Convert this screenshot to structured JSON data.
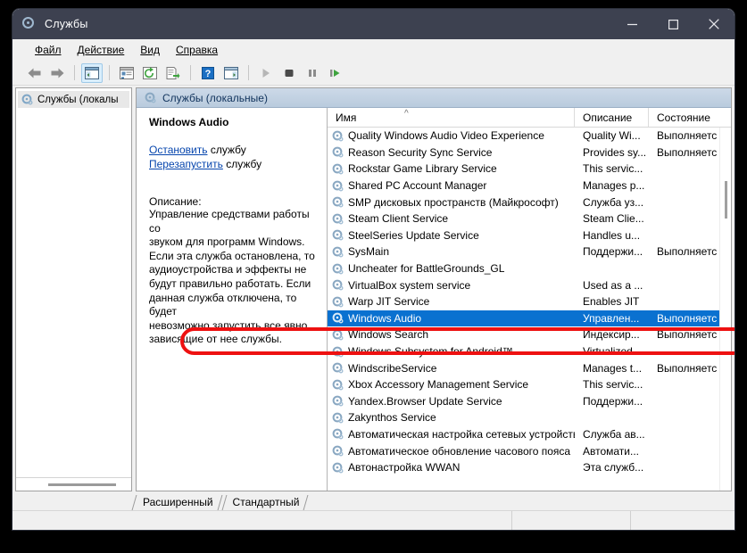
{
  "window": {
    "title": "Службы",
    "title_icon": "services-gear-icon",
    "minimize_label": "Свернуть",
    "maximize_label": "Развернуть",
    "close_label": "Закрыть"
  },
  "menubar": {
    "items": [
      {
        "label": "Файл",
        "accel": "Ф"
      },
      {
        "label": "Действие",
        "accel": "Д"
      },
      {
        "label": "Вид",
        "accel": "В"
      },
      {
        "label": "Справка",
        "accel": "С"
      }
    ]
  },
  "toolbar": {
    "buttons": [
      {
        "name": "back-icon",
        "label": "Назад"
      },
      {
        "name": "forward-icon",
        "label": "Вперед"
      },
      {
        "name": "show-hide-console-tree-icon",
        "label": "Показать или скрыть дерево консоли",
        "active": true
      },
      {
        "name": "properties-icon",
        "label": "Свойства"
      },
      {
        "name": "refresh-icon",
        "label": "Обновить"
      },
      {
        "name": "export-list-icon",
        "label": "Экспортировать список"
      },
      {
        "name": "help-icon",
        "label": "Справка"
      },
      {
        "name": "show-action-pane-icon",
        "label": "Показать область действий"
      },
      {
        "name": "start-service-icon",
        "label": "Запустить службу"
      },
      {
        "name": "stop-service-icon",
        "label": "Остановить службу"
      },
      {
        "name": "pause-service-icon",
        "label": "Приостановить службу"
      },
      {
        "name": "restart-service-icon",
        "label": "Перезапустить службу"
      }
    ]
  },
  "tree": {
    "item_label": "Службы (локалы",
    "item_icon": "services-gear-icon"
  },
  "detail": {
    "header_label": "Службы (локальные)",
    "header_icon": "services-gear-icon"
  },
  "info": {
    "service_name": "Windows Audio",
    "stop_link": "Остановить",
    "stop_suffix": " службу",
    "restart_link": "Перезапустить",
    "restart_suffix": " службу",
    "description_heading": "Описание:",
    "description_body": "Управление средствами работы со\nзвуком для программ Windows.\nЕсли эта служба остановлена, то\nаудиоустройства и эффекты не\nбудут правильно работать.  Если\nданная служба отключена, то будет\nневозможно запустить все явно\nзависящие от нее службы."
  },
  "list": {
    "columns": [
      {
        "key": "name",
        "label": "Имя",
        "sorted": true,
        "sort_dir": "asc"
      },
      {
        "key": "description",
        "label": "Описание"
      },
      {
        "key": "state",
        "label": "Состояние"
      }
    ],
    "rows": [
      {
        "name": "Quality Windows Audio Video Experience",
        "description": "Quality Wi...",
        "state": "Выполняетс",
        "selected": false
      },
      {
        "name": "Reason Security Sync Service",
        "description": "Provides sy...",
        "state": "Выполняетс",
        "selected": false
      },
      {
        "name": "Rockstar Game Library Service",
        "description": "This servic...",
        "state": "",
        "selected": false
      },
      {
        "name": "Shared PC Account Manager",
        "description": "Manages p...",
        "state": "",
        "selected": false
      },
      {
        "name": "SMP дисковых пространств (Майкрософт)",
        "description": "Служба уз...",
        "state": "",
        "selected": false
      },
      {
        "name": "Steam Client Service",
        "description": "Steam Clie...",
        "state": "",
        "selected": false
      },
      {
        "name": "SteelSeries Update Service",
        "description": "Handles u...",
        "state": "",
        "selected": false
      },
      {
        "name": "SysMain",
        "description": "Поддержи...",
        "state": "Выполняетс",
        "selected": false
      },
      {
        "name": "Uncheater for BattleGrounds_GL",
        "description": "",
        "state": "",
        "selected": false
      },
      {
        "name": "VirtualBox system service",
        "description": "Used as a ...",
        "state": "",
        "selected": false
      },
      {
        "name": "Warp JIT Service",
        "description": "Enables JIT",
        "state": "",
        "selected": false
      },
      {
        "name": "Windows Audio",
        "description": "Управлен...",
        "state": "Выполняетс",
        "selected": true
      },
      {
        "name": "Windows Search",
        "description": "Индексир...",
        "state": "Выполняетс",
        "selected": false
      },
      {
        "name": "Windows Subsystem for Android™",
        "description": "Virtualized ...",
        "state": "",
        "selected": false
      },
      {
        "name": "WindscribeService",
        "description": "Manages t...",
        "state": "Выполняетс",
        "selected": false
      },
      {
        "name": "Xbox Accessory Management Service",
        "description": "This servic...",
        "state": "",
        "selected": false
      },
      {
        "name": "Yandex.Browser Update Service",
        "description": "Поддержи...",
        "state": "",
        "selected": false
      },
      {
        "name": "Zakynthos Service",
        "description": "",
        "state": "",
        "selected": false
      },
      {
        "name": "Автоматическая настройка сетевых устройств",
        "description": "Служба ав...",
        "state": "",
        "selected": false
      },
      {
        "name": "Автоматическое обновление часового пояса",
        "description": "Автомати...",
        "state": "",
        "selected": false
      },
      {
        "name": "Автонастройка WWAN",
        "description": "Эта служб...",
        "state": "",
        "selected": false
      }
    ]
  },
  "tabs": [
    {
      "label": "Расширенный",
      "active": true
    },
    {
      "label": "Стандартный",
      "active": false
    }
  ],
  "annotation": {
    "name": "red-highlight-box",
    "color": "#ee1111",
    "target": "Windows Audio"
  }
}
